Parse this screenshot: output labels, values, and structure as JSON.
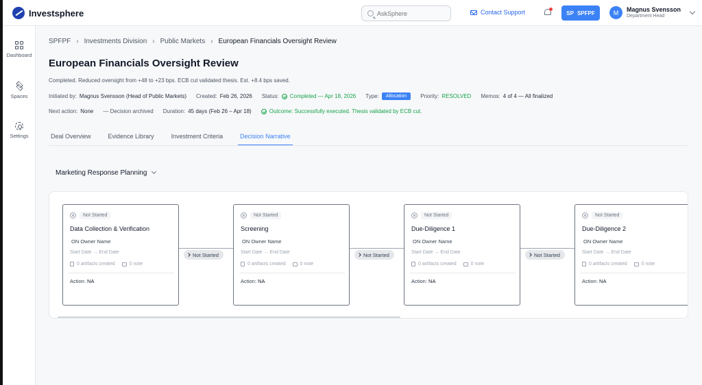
{
  "app": {
    "name": "Investsphere"
  },
  "header": {
    "search_placeholder": "AskSphere",
    "contact_label": "Contact Support",
    "org_initials": "SP",
    "org_name": "SPFPF",
    "user_initial": "M",
    "user_name": "Magnus Svensson",
    "user_role": "Department Head"
  },
  "sidebar": {
    "items": [
      {
        "label": "Dashboard",
        "icon": "grid-icon"
      },
      {
        "label": "Spaces",
        "icon": "layers-icon"
      },
      {
        "label": "Settings",
        "icon": "gear-icon"
      }
    ]
  },
  "breadcrumb": [
    "SPFPF",
    "Investments Division",
    "Public Markets",
    "European Financials Oversight Review"
  ],
  "page": {
    "title": "European Financials Oversight Review",
    "summary": "Completed. Reduced oversight from +48 to +23 bps. ECB cut validated thesis. Est. +8.4 bps saved.",
    "initiated_label": "Initiated by:",
    "initiated_value": "Magnus Svensson (Head of Public Markets)",
    "created_label": "Created:",
    "created_value": "Feb 26, 2026",
    "status_label": "Status:",
    "status_value": "Completed — Apr 18, 2026",
    "type_label": "Type:",
    "type_value": "Allocation",
    "priority_label": "Priority:",
    "priority_value": "RESOLVED",
    "memos_label": "Memos:",
    "memos_value": "4 of 4 — All finalized",
    "next_action_label": "Next action:",
    "next_action_value": "None",
    "decision_value": "— Decision archived",
    "duration_label": "Duration:",
    "duration_value": "45 days (Feb 26 – Apr 18)",
    "outcome_value": "Outcome: Successfully executed. Thesis validated by ECB cut."
  },
  "tabs": [
    "Deal Overview",
    "Evidence Library",
    "Investment Criteria",
    "Decision Narrative"
  ],
  "active_tab": "Decision Narrative",
  "section": {
    "selected": "Marketing Response Planning"
  },
  "stages": [
    {
      "status": "Not Started",
      "title": "Data Collection & Verification",
      "owner": "ON  Owner Name",
      "dates": "Start Date → End Date",
      "artifacts": "0 artifacts created",
      "notes": "0 note",
      "action_label": "Action:",
      "action_value": "NA"
    },
    {
      "status": "Not Started",
      "title": "Screening",
      "owner": "ON  Owner Name",
      "dates": "Start Date → End Date",
      "artifacts": "0 artifacts created",
      "notes": "0 note",
      "action_label": "Action:",
      "action_value": "NA"
    },
    {
      "status": "Not Started",
      "title": "Due-Diligence 1",
      "owner": "ON  Owner Name",
      "dates": "Start Date → End Date",
      "artifacts": "0 artifacts created",
      "notes": "0 note",
      "action_label": "Action:",
      "action_value": "NA"
    },
    {
      "status": "Not Started",
      "title": "Due-Diligence 2",
      "owner": "ON  Owner Name",
      "dates": "Start Date → End Date",
      "artifacts": "0 artifacts created",
      "notes": "0 note",
      "action_label": "Action:",
      "action_value": "NA"
    }
  ],
  "connectors": [
    "Not Started",
    "Not Started",
    "Not Started"
  ],
  "colors": {
    "accent": "#3b82f6",
    "success": "#16a34a",
    "brand": "#1e40af",
    "alert": "#ef4444"
  }
}
